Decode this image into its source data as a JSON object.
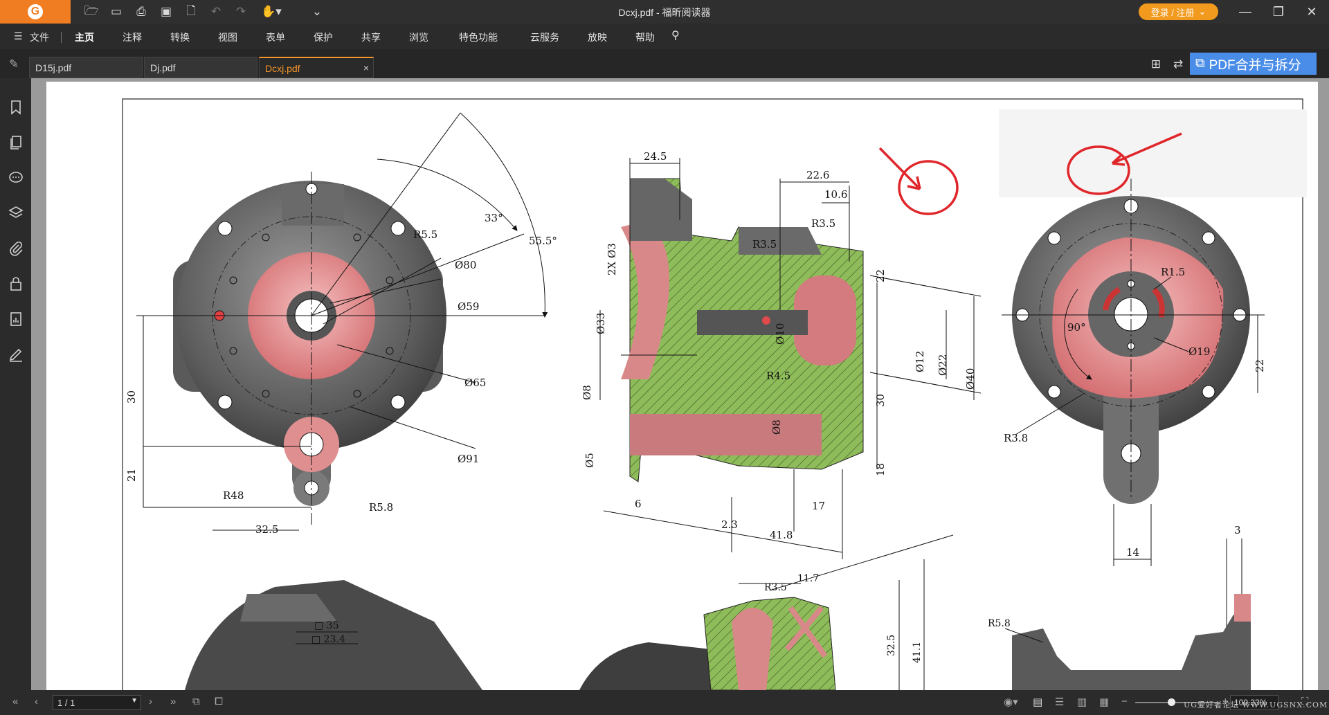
{
  "window": {
    "title": "Dcxj.pdf - 福昕阅读器",
    "login_label": "登录 / 注册"
  },
  "menu": {
    "file_label": "文件",
    "items": [
      "主页",
      "注释",
      "转换",
      "视图",
      "表单",
      "保护",
      "共享",
      "浏览",
      "特色功能",
      "云服务",
      "放映",
      "帮助"
    ]
  },
  "tabs": [
    {
      "label": "D15j.pdf"
    },
    {
      "label": "Dj.pdf"
    },
    {
      "label": "Dcxj.pdf",
      "close": "×"
    }
  ],
  "promo": {
    "label": "PDF合并与拆分"
  },
  "status": {
    "page": "1 / 1",
    "zoom": "100.33%",
    "watermark": "UG爱好者论坛 WWW.UGSNX.COM"
  },
  "drawing": {
    "left_view": [
      "R5.5",
      "Ø80",
      "Ø59",
      "Ø65",
      "Ø91",
      "R5.8",
      "R48",
      "33°",
      "55.5°",
      "30",
      "21",
      "32.5"
    ],
    "section_view": [
      "24.5",
      "22.6",
      "10.6",
      "2X Ø3",
      "R3.5",
      "Ø33",
      "Ø10",
      "Ø12",
      "Ø22",
      "Ø40",
      "Ø8",
      "R4.5",
      "Ø8",
      "30",
      "Ø5",
      "18",
      "6",
      "2.3",
      "41.8",
      "17",
      "22"
    ],
    "right_view": [
      "R1.5",
      "90°",
      "Ø19",
      "R3.8",
      "22",
      "14",
      "3"
    ],
    "bottom_views": [
      "R5.8",
      "R3.5",
      "11.7",
      "32.5",
      "41.1",
      "35",
      "23.4"
    ]
  },
  "colors": {
    "accent": "#f5962a",
    "promo": "#4a8de8",
    "section_fill": "#8fbc5a",
    "bore_fill": "#e28a8a",
    "annotation": "#e0262a"
  }
}
